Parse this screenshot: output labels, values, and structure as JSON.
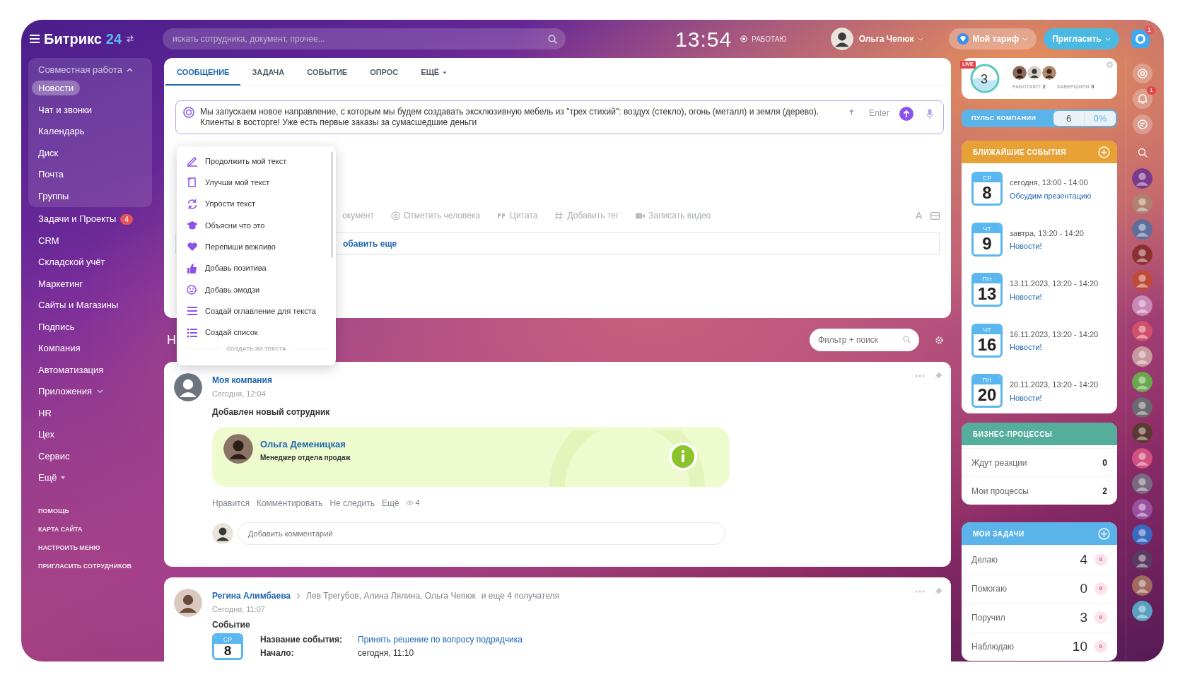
{
  "header": {
    "logo": "Битрикс",
    "logo_number": "24",
    "search_placeholder": "искать сотрудника, документ, прочее...",
    "clock": "13:54",
    "work_status": "РАБОТАЮ",
    "user": "Ольга Чепюк",
    "tariff": "Мой тариф",
    "invite": "Пригласить",
    "help_badge": "1"
  },
  "sidebar": {
    "group": {
      "label": "Совместная работа",
      "expanded": true,
      "items": [
        {
          "label": "Новости",
          "selected": true
        },
        {
          "label": "Чат и звонки",
          "selected": false
        },
        {
          "label": "Календарь",
          "selected": false
        },
        {
          "label": "Диск",
          "selected": false
        },
        {
          "label": "Почта",
          "selected": false
        },
        {
          "label": "Группы",
          "selected": false
        }
      ]
    },
    "items": [
      {
        "label": "Задачи и Проекты",
        "kind": "link",
        "counter": "4"
      },
      {
        "label": "CRM",
        "kind": "link"
      },
      {
        "label": "Складской учёт",
        "kind": "link"
      },
      {
        "label": "Маркетинг",
        "kind": "link"
      },
      {
        "label": "Сайты и Магазины",
        "kind": "link"
      },
      {
        "label": "Подпись",
        "kind": "link"
      },
      {
        "label": "Компания",
        "kind": "link"
      },
      {
        "label": "Автоматизация",
        "kind": "link"
      },
      {
        "label": "Приложения",
        "kind": "menu"
      },
      {
        "label": "HR",
        "kind": "link"
      },
      {
        "label": "Цех",
        "kind": "link"
      },
      {
        "label": "Сервис",
        "kind": "link"
      },
      {
        "label": "Ещё",
        "kind": "more"
      }
    ],
    "footer_links": [
      "ПОМОЩЬ",
      "КАРТА САЙТА",
      "НАСТРОИТЬ МЕНЮ",
      "ПРИГЛАСИТЬ СОТРУДНИКОВ"
    ]
  },
  "composer": {
    "tabs": [
      {
        "label": "СООБЩЕНИЕ",
        "selected": true,
        "kind": "tab"
      },
      {
        "label": "ЗАДАЧА",
        "selected": false,
        "kind": "tab"
      },
      {
        "label": "СОБЫТИЕ",
        "selected": false,
        "kind": "tab"
      },
      {
        "label": "ОПРОС",
        "selected": false,
        "kind": "tab"
      },
      {
        "label": "ЕЩЁ",
        "selected": false,
        "kind": "menu"
      }
    ],
    "text": "Мы запускаем новое направление, с которым мы будем создавать эксклюзивную мебель из \"трех стихий\": воздух (стекло), огонь (металл) и земля (дерево). Клиенты в восторге! Уже есть первые заказы за сумасшедшие деньги",
    "enter_hint": "Enter",
    "toolbar": [
      {
        "label": "окумент"
      },
      {
        "label": "Отметить человека"
      },
      {
        "label": "Цитата"
      },
      {
        "label": "Добавить тег"
      },
      {
        "label": "Записать видео"
      }
    ],
    "format_button": "A",
    "recipients_hint": "обавить еще",
    "ai_menu": {
      "items": [
        "Продолжить мой текст",
        "Улучши мой текст",
        "Упрости текст",
        "Объясни что это",
        "Перепиши вежливо",
        "Добавь позитива",
        "Добавь эмодзи",
        "Создай оглавление для текста",
        "Создай список"
      ],
      "section": "СОЗДАТЬ ИЗ ТЕКСТА"
    }
  },
  "feed": {
    "title": "Н",
    "filter_placeholder": "Фильтр + поиск",
    "posts": [
      {
        "kind": "employee",
        "author": "Моя компания",
        "time": "Сегодня, 12:04",
        "title": "Добавлен новый сотрудник",
        "employee": {
          "name": "Ольга Деменицкая",
          "role": "Менеджер отдела продаж"
        },
        "actions": [
          "Нравится",
          "Комментировать",
          "Не следить",
          "Ещё"
        ],
        "views": "4",
        "comment_placeholder": "Добавить комментарий"
      },
      {
        "kind": "event",
        "author": "Регина Алимбаева",
        "recipients": "Лев Трегубов, Алина Лялина, Ольга Чепюк",
        "recipients_more": "и еще 4 получателя",
        "time": "Сегодня, 11:07",
        "title": "Событие",
        "weekday": "СР",
        "day": "8",
        "fields": [
          {
            "label": "Название события:",
            "value": "Принять решение по вопросу подрядчика",
            "kind": "link"
          },
          {
            "label": "Начало:",
            "value": "сегодня, 11:10",
            "kind": "text"
          }
        ]
      }
    ]
  },
  "live": {
    "badge": "LIVE",
    "count": "3",
    "working_label": "РАБОТАЮТ",
    "working": "2",
    "finished_label": "ЗАВЕРШИЛИ",
    "finished": "0"
  },
  "pulse": {
    "label": "ПУЛЬС КОМПАНИИ",
    "value": "6",
    "percent": "0%"
  },
  "events": {
    "title": "БЛИЖАЙШИЕ СОБЫТИЯ",
    "items": [
      {
        "weekday": "СР",
        "day": "8",
        "time": "сегодня, 13:00 - 14:00",
        "title": "Обсудим презентацию"
      },
      {
        "weekday": "ЧТ",
        "day": "9",
        "time": "завтра, 13:20 - 14:20",
        "title": "Новости!"
      },
      {
        "weekday": "ПН",
        "day": "13",
        "time": "13.11.2023, 13:20 - 14:20",
        "title": "Новости!"
      },
      {
        "weekday": "ЧТ",
        "day": "16",
        "time": "16.11.2023, 13:20 - 14:20",
        "title": "Новости!"
      },
      {
        "weekday": "ПН",
        "day": "20",
        "time": "20.11.2023, 13:20 - 14:20",
        "title": "Новости!"
      }
    ]
  },
  "processes": {
    "title": "БИЗНЕС-ПРОЦЕССЫ",
    "rows": [
      {
        "label": "Ждут реакции",
        "count": "0"
      },
      {
        "label": "Мои процессы",
        "count": "2"
      }
    ]
  },
  "tasks": {
    "title": "МОИ ЗАДАЧИ",
    "rows": [
      {
        "label": "Делаю",
        "count": "4",
        "expired": "0"
      },
      {
        "label": "Помогаю",
        "count": "0",
        "expired": "0"
      },
      {
        "label": "Поручил",
        "count": "3",
        "expired": "0"
      },
      {
        "label": "Наблюдаю",
        "count": "10",
        "expired": "0"
      }
    ]
  },
  "rail": {
    "bell_badge": "1"
  }
}
